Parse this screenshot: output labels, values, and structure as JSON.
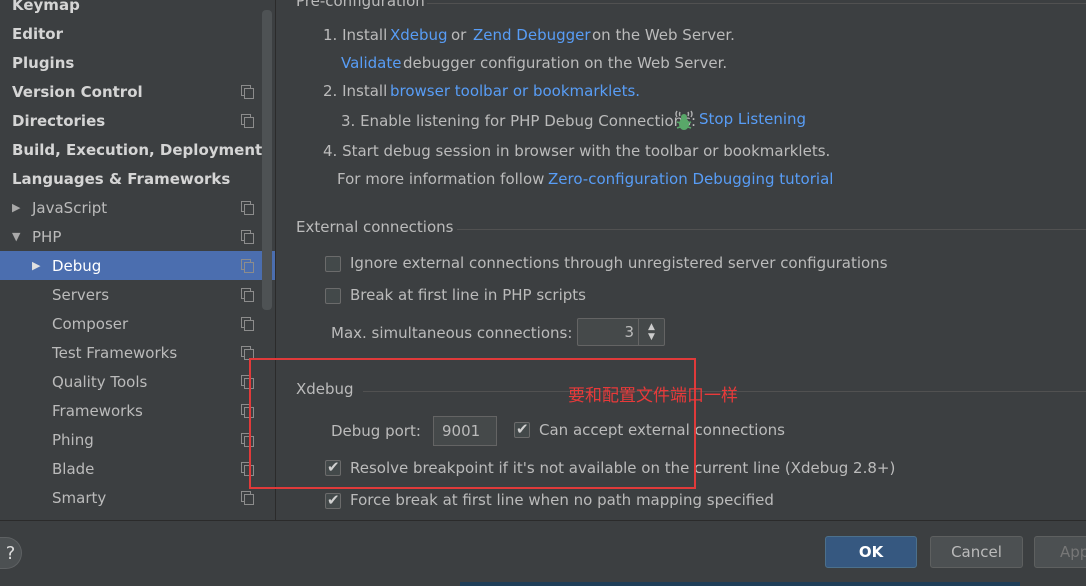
{
  "sidebar": {
    "items": [
      {
        "label": "Keymap",
        "bold": true,
        "arrow": "",
        "copy": false
      },
      {
        "label": "Editor",
        "bold": true,
        "arrow": "",
        "copy": false
      },
      {
        "label": "Plugins",
        "bold": true,
        "arrow": "",
        "copy": false
      },
      {
        "label": "Version Control",
        "bold": true,
        "arrow": "",
        "copy": true
      },
      {
        "label": "Directories",
        "bold": true,
        "arrow": "",
        "copy": true
      },
      {
        "label": "Build, Execution, Deployment",
        "bold": true,
        "arrow": "",
        "copy": false
      },
      {
        "label": "Languages & Frameworks",
        "bold": true,
        "arrow": "",
        "copy": false
      },
      {
        "label": "JavaScript",
        "bold": false,
        "arrow": "▶",
        "copy": true
      },
      {
        "label": "PHP",
        "bold": false,
        "arrow": "▼",
        "copy": true
      },
      {
        "label": "Debug",
        "bold": false,
        "arrow": "▶",
        "copy": true
      },
      {
        "label": "Servers",
        "bold": false,
        "arrow": "",
        "copy": true
      },
      {
        "label": "Composer",
        "bold": false,
        "arrow": "",
        "copy": true
      },
      {
        "label": "Test Frameworks",
        "bold": false,
        "arrow": "",
        "copy": true
      },
      {
        "label": "Quality Tools",
        "bold": false,
        "arrow": "",
        "copy": true
      },
      {
        "label": "Frameworks",
        "bold": false,
        "arrow": "",
        "copy": true
      },
      {
        "label": "Phing",
        "bold": false,
        "arrow": "",
        "copy": true
      },
      {
        "label": "Blade",
        "bold": false,
        "arrow": "",
        "copy": true
      },
      {
        "label": "Smarty",
        "bold": false,
        "arrow": "",
        "copy": true
      }
    ],
    "selected_index": 9
  },
  "preconfig": {
    "title": "Pre-configuration",
    "step1_prefix": "1. Install",
    "xdebug_link": "Xdebug",
    "or": "or",
    "zend_link": "Zend Debugger",
    "step1_suffix": "on the Web Server.",
    "validate_link": "Validate",
    "validate_suffix": "debugger configuration on the Web Server.",
    "step2_prefix": "2. Install",
    "toolbar_link": "browser toolbar or bookmarklets.",
    "step3_prefix": "3. Enable listening for PHP Debug Connections:",
    "stop_listening_link": "Stop Listening",
    "step4": "4. Start debug session in browser with the toolbar or bookmarklets.",
    "more_info_prefix": "For more information follow",
    "tutorial_link": "Zero-configuration Debugging tutorial"
  },
  "external": {
    "title": "External connections",
    "ignore_label": "Ignore external connections through unregistered server configurations",
    "ignore_checked": false,
    "break_label": "Break at first line in PHP scripts",
    "break_checked": false,
    "max_label": "Max. simultaneous connections:",
    "max_value": "3"
  },
  "xdebug": {
    "title": "Xdebug",
    "port_label": "Debug port:",
    "port_value": "9001",
    "accept_label": "Can accept external connections",
    "accept_checked": true,
    "resolve_label": "Resolve breakpoint if it's not available on the current line (Xdebug 2.8+)",
    "resolve_checked": true,
    "force_label": "Force break at first line when no path mapping specified",
    "force_checked": true
  },
  "annotation": {
    "text": "要和配置文件端口一样",
    "color": "#e83a3a"
  },
  "footer": {
    "help": "?",
    "ok": "OK",
    "cancel": "Cancel",
    "apply": "App"
  },
  "colors": {
    "background": "#3c3f41",
    "selected": "#4b6eaf",
    "link": "#589df6",
    "primary_button": "#365880"
  }
}
